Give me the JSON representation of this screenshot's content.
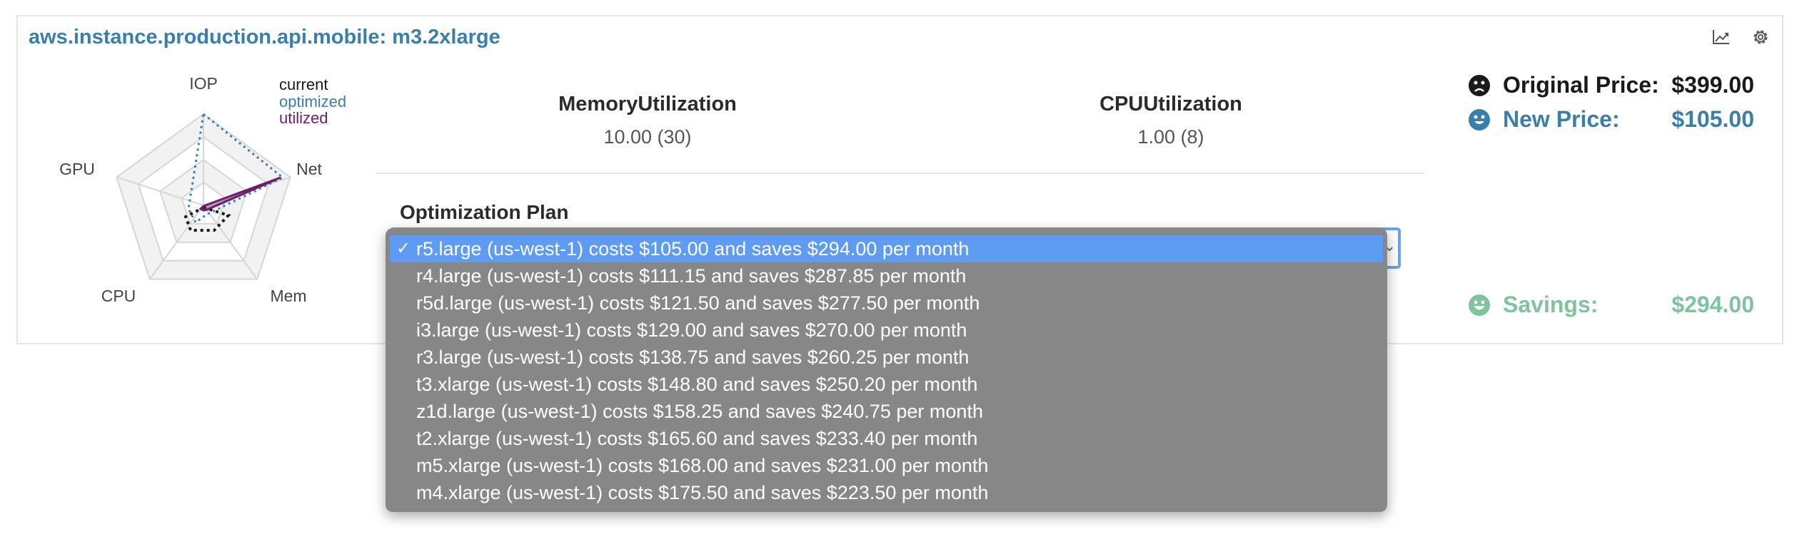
{
  "header": {
    "title": "aws.instance.production.api.mobile: m3.2xlarge",
    "icons": [
      "chart-icon",
      "gear-icon"
    ]
  },
  "radar": {
    "axes": [
      "IOP",
      "Net",
      "Mem",
      "CPU",
      "GPU"
    ],
    "legend": [
      {
        "label": "current",
        "color": "#1a1a1a"
      },
      {
        "label": "optimized",
        "color": "#3a7fa9"
      },
      {
        "label": "utilized",
        "color": "#6b1f6b"
      }
    ]
  },
  "metrics": [
    {
      "name": "MemoryUtilization",
      "value": "10.00 (30)"
    },
    {
      "name": "CPUUtilization",
      "value": "1.00 (8)"
    }
  ],
  "plan": {
    "label": "Optimization Plan",
    "selected_index": 0,
    "options": [
      "r5.large (us-west-1) costs $105.00 and saves $294.00 per month",
      "r4.large (us-west-1) costs $111.15 and saves $287.85 per month",
      "r5d.large (us-west-1) costs $121.50 and saves $277.50 per month",
      "i3.large (us-west-1) costs $129.00 and saves $270.00 per month",
      "r3.large (us-west-1) costs $138.75 and saves $260.25 per month",
      "t3.xlarge (us-west-1) costs $148.80 and saves $250.20 per month",
      "z1d.large (us-west-1) costs $158.25 and saves $240.75 per month",
      "t2.xlarge (us-west-1) costs $165.60 and saves $233.40 per month",
      "m5.xlarge (us-west-1) costs $168.00 and saves $231.00 per month",
      "m4.xlarge (us-west-1) costs $175.50 and saves $223.50 per month"
    ]
  },
  "prices": {
    "original": {
      "label": "Original Price:",
      "value": "$399.00",
      "icon": "sad-face-icon",
      "color": "#1a1a1a"
    },
    "new": {
      "label": "New Price:",
      "value": "$105.00",
      "icon": "smile-face-icon",
      "color": "#3a7fa9"
    },
    "savings": {
      "label": "Savings:",
      "value": "$294.00",
      "icon": "grin-face-icon",
      "color": "#7fc39f"
    }
  }
}
